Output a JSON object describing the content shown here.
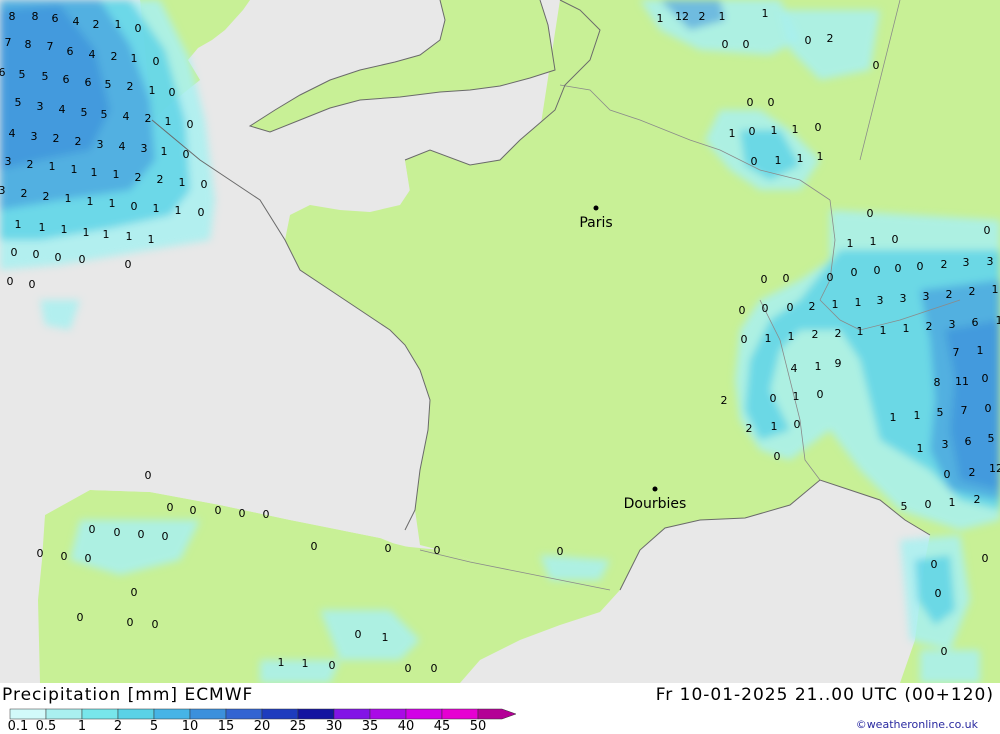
{
  "title": "Precipitation [mm] ECMWF",
  "datetime": "Fr 10-01-2025 21..00 UTC (00+120)",
  "credit": "©weatheronline.co.uk",
  "colors": {
    "sea": "#e8e8e8",
    "land": "#c8f096",
    "coast": "#8a8a8a",
    "precip_light": "#a8f0f0",
    "precip_mid": "#5ad2e6",
    "precip_heavy": "#3c90dc"
  },
  "legend": {
    "labels": [
      "0.1",
      "0.5",
      "1",
      "2",
      "5",
      "10",
      "15",
      "20",
      "25",
      "30",
      "35",
      "40",
      "45",
      "50"
    ],
    "colors": [
      "#d2fafa",
      "#aaf0f0",
      "#78e6eb",
      "#5ad2e6",
      "#46b4e6",
      "#3c90dc",
      "#3264d2",
      "#1e3cbe",
      "#1414a0",
      "#8214e6",
      "#aa0ae6",
      "#d200e6",
      "#e600d2",
      "#b40096"
    ]
  },
  "cities": [
    {
      "name": "Paris"
    },
    {
      "name": "Dourbies"
    }
  ],
  "values": [
    {
      "t": "8"
    },
    {
      "t": "8"
    },
    {
      "t": "6"
    },
    {
      "t": "4"
    },
    {
      "t": "2"
    },
    {
      "t": "1"
    },
    {
      "t": "0"
    },
    {
      "t": "7"
    },
    {
      "t": "8"
    },
    {
      "t": "7"
    },
    {
      "t": "6"
    },
    {
      "t": "4"
    },
    {
      "t": "2"
    },
    {
      "t": "1"
    },
    {
      "t": "0"
    },
    {
      "t": "6"
    },
    {
      "t": "5"
    },
    {
      "t": "5"
    },
    {
      "t": "6"
    },
    {
      "t": "6"
    },
    {
      "t": "5"
    },
    {
      "t": "2"
    },
    {
      "t": "1"
    },
    {
      "t": "0"
    },
    {
      "t": "5"
    },
    {
      "t": "3"
    },
    {
      "t": "4"
    },
    {
      "t": "5"
    },
    {
      "t": "5"
    },
    {
      "t": "4"
    },
    {
      "t": "2"
    },
    {
      "t": "1"
    },
    {
      "t": "0"
    },
    {
      "t": "4"
    },
    {
      "t": "3"
    },
    {
      "t": "2"
    },
    {
      "t": "2"
    },
    {
      "t": "3"
    },
    {
      "t": "4"
    },
    {
      "t": "3"
    },
    {
      "t": "1"
    },
    {
      "t": "0"
    },
    {
      "t": "3"
    },
    {
      "t": "2"
    },
    {
      "t": "1"
    },
    {
      "t": "1"
    },
    {
      "t": "1"
    },
    {
      "t": "1"
    },
    {
      "t": "2"
    },
    {
      "t": "2"
    },
    {
      "t": "1"
    },
    {
      "t": "0"
    },
    {
      "t": "3"
    },
    {
      "t": "2"
    },
    {
      "t": "2"
    },
    {
      "t": "1"
    },
    {
      "t": "1"
    },
    {
      "t": "1"
    },
    {
      "t": "0"
    },
    {
      "t": "1"
    },
    {
      "t": "1"
    },
    {
      "t": "0"
    },
    {
      "t": "1"
    },
    {
      "t": "1"
    },
    {
      "t": "1"
    },
    {
      "t": "1"
    },
    {
      "t": "1"
    },
    {
      "t": "1"
    },
    {
      "t": "1"
    },
    {
      "t": "0"
    },
    {
      "t": "0"
    },
    {
      "t": "0"
    },
    {
      "t": "0"
    },
    {
      "t": "0"
    },
    {
      "t": "0"
    },
    {
      "t": "0"
    },
    {
      "t": "1"
    },
    {
      "t": "12"
    },
    {
      "t": "2"
    },
    {
      "t": "1"
    },
    {
      "t": "1"
    },
    {
      "t": "0"
    },
    {
      "t": "0"
    },
    {
      "t": "0"
    },
    {
      "t": "2"
    },
    {
      "t": "0"
    },
    {
      "t": "0"
    },
    {
      "t": "0"
    },
    {
      "t": "1"
    },
    {
      "t": "0"
    },
    {
      "t": "1"
    },
    {
      "t": "1"
    },
    {
      "t": "0"
    },
    {
      "t": "0"
    },
    {
      "t": "1"
    },
    {
      "t": "1"
    },
    {
      "t": "1"
    },
    {
      "t": "0"
    },
    {
      "t": "0"
    },
    {
      "t": "1"
    },
    {
      "t": "1"
    },
    {
      "t": "0"
    },
    {
      "t": "0"
    },
    {
      "t": "0"
    },
    {
      "t": "0"
    },
    {
      "t": "0"
    },
    {
      "t": "0"
    },
    {
      "t": "0"
    },
    {
      "t": "0"
    },
    {
      "t": "2"
    },
    {
      "t": "3"
    },
    {
      "t": "3"
    },
    {
      "t": "0"
    },
    {
      "t": "0"
    },
    {
      "t": "0"
    },
    {
      "t": "2"
    },
    {
      "t": "1"
    },
    {
      "t": "1"
    },
    {
      "t": "3"
    },
    {
      "t": "3"
    },
    {
      "t": "3"
    },
    {
      "t": "2"
    },
    {
      "t": "2"
    },
    {
      "t": "1"
    },
    {
      "t": "0"
    },
    {
      "t": "1"
    },
    {
      "t": "1"
    },
    {
      "t": "2"
    },
    {
      "t": "2"
    },
    {
      "t": "1"
    },
    {
      "t": "1"
    },
    {
      "t": "1"
    },
    {
      "t": "2"
    },
    {
      "t": "3"
    },
    {
      "t": "6"
    },
    {
      "t": "1"
    },
    {
      "t": "4"
    },
    {
      "t": "1"
    },
    {
      "t": "9"
    },
    {
      "t": "7"
    },
    {
      "t": "1"
    },
    {
      "t": "8"
    },
    {
      "t": "11"
    },
    {
      "t": "0"
    },
    {
      "t": "2"
    },
    {
      "t": "0"
    },
    {
      "t": "1"
    },
    {
      "t": "0"
    },
    {
      "t": "2"
    },
    {
      "t": "1"
    },
    {
      "t": "0"
    },
    {
      "t": "1"
    },
    {
      "t": "1"
    },
    {
      "t": "5"
    },
    {
      "t": "7"
    },
    {
      "t": "0"
    },
    {
      "t": "0"
    },
    {
      "t": "1"
    },
    {
      "t": "3"
    },
    {
      "t": "6"
    },
    {
      "t": "5"
    },
    {
      "t": "0"
    },
    {
      "t": "2"
    },
    {
      "t": "12"
    },
    {
      "t": "5"
    },
    {
      "t": "0"
    },
    {
      "t": "1"
    },
    {
      "t": "2"
    },
    {
      "t": "0"
    },
    {
      "t": "0"
    },
    {
      "t": "0"
    },
    {
      "t": "0"
    },
    {
      "t": "0"
    },
    {
      "t": "0"
    },
    {
      "t": "0"
    },
    {
      "t": "0"
    },
    {
      "t": "0"
    },
    {
      "t": "0"
    },
    {
      "t": "0"
    },
    {
      "t": "0"
    },
    {
      "t": "0"
    },
    {
      "t": "0"
    },
    {
      "t": "0"
    },
    {
      "t": "0"
    },
    {
      "t": "0"
    },
    {
      "t": "0"
    },
    {
      "t": "0"
    },
    {
      "t": "0"
    },
    {
      "t": "0"
    },
    {
      "t": "0"
    },
    {
      "t": "0"
    },
    {
      "t": "0"
    },
    {
      "t": "1"
    },
    {
      "t": "0"
    },
    {
      "t": "1"
    },
    {
      "t": "1"
    },
    {
      "t": "0"
    },
    {
      "t": "0"
    },
    {
      "t": "0"
    },
    {
      "t": "0"
    },
    {
      "t": "0"
    },
    {
      "t": "0"
    },
    {
      "t": "1"
    },
    {
      "t": "1"
    },
    {
      "t": "0"
    }
  ]
}
